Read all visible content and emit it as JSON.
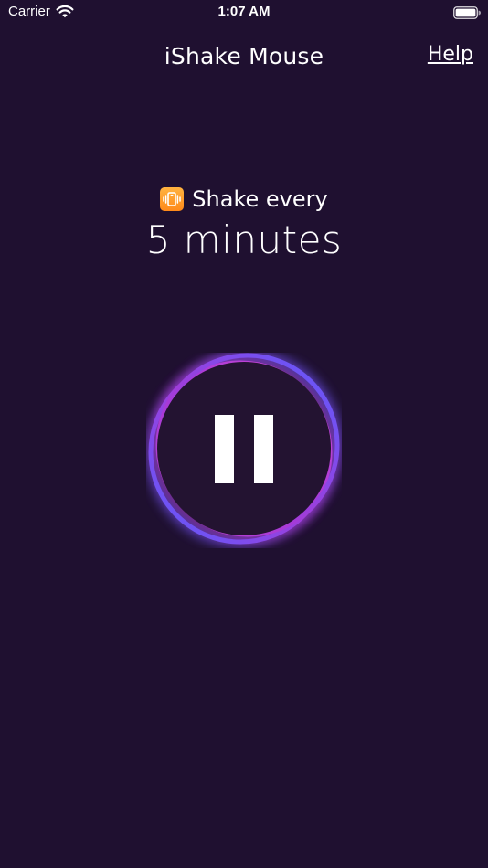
{
  "status_bar": {
    "carrier": "Carrier",
    "time": "1:07 AM",
    "wifi_icon": "wifi-icon",
    "battery_icon": "battery-full-icon"
  },
  "nav": {
    "title": "iShake Mouse",
    "help_label": "Help"
  },
  "interval": {
    "icon": "vibrate-mode-icon",
    "label": "Shake every",
    "value": "5 minutes"
  },
  "control": {
    "state": "running",
    "icon": "pause-icon",
    "ring_colors": [
      "#5b5cff",
      "#a63ad6",
      "#d148d4"
    ],
    "inner_color": "#231331",
    "background": "#1f1030"
  }
}
